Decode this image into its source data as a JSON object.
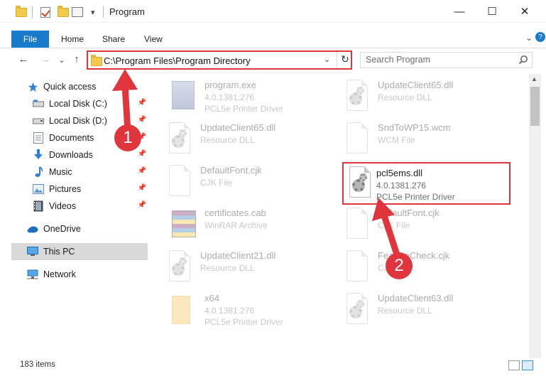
{
  "window": {
    "title": "Program",
    "quick_access_dropdown": "▾",
    "minimize": "—",
    "maximize": "☐",
    "close": "✕"
  },
  "ribbon": {
    "file": "File",
    "home": "Home",
    "share": "Share",
    "view": "View",
    "collapse": "⌄",
    "help": "?"
  },
  "nav": {
    "back": "←",
    "forward": "→",
    "recent": "⌄",
    "up": "↑"
  },
  "address": {
    "path": "C:\\Program Files\\Program Directory",
    "dropdown": "⌄",
    "refresh": "↻"
  },
  "search": {
    "placeholder": "Search Program"
  },
  "sidebar": {
    "items": [
      {
        "label": "Quick access",
        "icon": "star-icon",
        "pinned": false
      },
      {
        "label": "Local Disk (C:)",
        "icon": "drive-icon",
        "pinned": true
      },
      {
        "label": "Local Disk (D:)",
        "icon": "drive-icon",
        "pinned": true
      },
      {
        "label": "Documents",
        "icon": "documents-icon",
        "pinned": true
      },
      {
        "label": "Downloads",
        "icon": "download-icon",
        "pinned": true
      },
      {
        "label": "Music",
        "icon": "music-icon",
        "pinned": true
      },
      {
        "label": "Pictures",
        "icon": "pictures-icon",
        "pinned": true
      },
      {
        "label": "Videos",
        "icon": "videos-icon",
        "pinned": true
      },
      {
        "label": "OneDrive",
        "icon": "cloud-icon",
        "pinned": false
      },
      {
        "label": "This PC",
        "icon": "computer-icon",
        "pinned": false
      },
      {
        "label": "Network",
        "icon": "network-icon",
        "pinned": false
      }
    ],
    "pin_glyph": "📌"
  },
  "files": [
    {
      "name": "program.exe",
      "line1": "4.0.1381.276",
      "line2": "PCL5e Printer Driver",
      "icon": "exe-icon"
    },
    {
      "name": "UpdateClient65.dll",
      "line1": "Resource DLL",
      "line2": "",
      "icon": "dll-icon"
    },
    {
      "name": "UpdateClient65.dll",
      "line1": "Resource DLL",
      "line2": "",
      "icon": "dll-icon"
    },
    {
      "name": "SndToWP15.wcm",
      "line1": "WCM File",
      "line2": "",
      "icon": "file-icon"
    },
    {
      "name": "DefaultFont.cjk",
      "line1": "CJK File",
      "line2": "",
      "icon": "file-icon"
    },
    {
      "name": "pcl5ems.dll",
      "line1": "4.0.1381.276",
      "line2": "PCL5e Printer Driver",
      "icon": "dll-icon"
    },
    {
      "name": "certificates.cab",
      "line1": "WinRAR Archive",
      "line2": "",
      "icon": "archive-icon"
    },
    {
      "name": "DefaultFont.cjk",
      "line1": "CJK File",
      "line2": "",
      "icon": "file-icon"
    },
    {
      "name": "UpdateClient21.dll",
      "line1": "Resource DLL",
      "line2": "",
      "icon": "dll-icon"
    },
    {
      "name": "FeatureCheck.cjk",
      "line1": "CJK File",
      "line2": "",
      "icon": "file-icon"
    },
    {
      "name": "x64",
      "line1": "4.0.1381.276",
      "line2": "PCL5e Printer Driver",
      "icon": "folder-icon"
    },
    {
      "name": "UpdateClient63.dll",
      "line1": "Resource DLL",
      "line2": "",
      "icon": "dll-icon"
    }
  ],
  "status": {
    "count": "183 items"
  },
  "annotations": {
    "one": "1",
    "two": "2",
    "color": "#e1353d"
  }
}
